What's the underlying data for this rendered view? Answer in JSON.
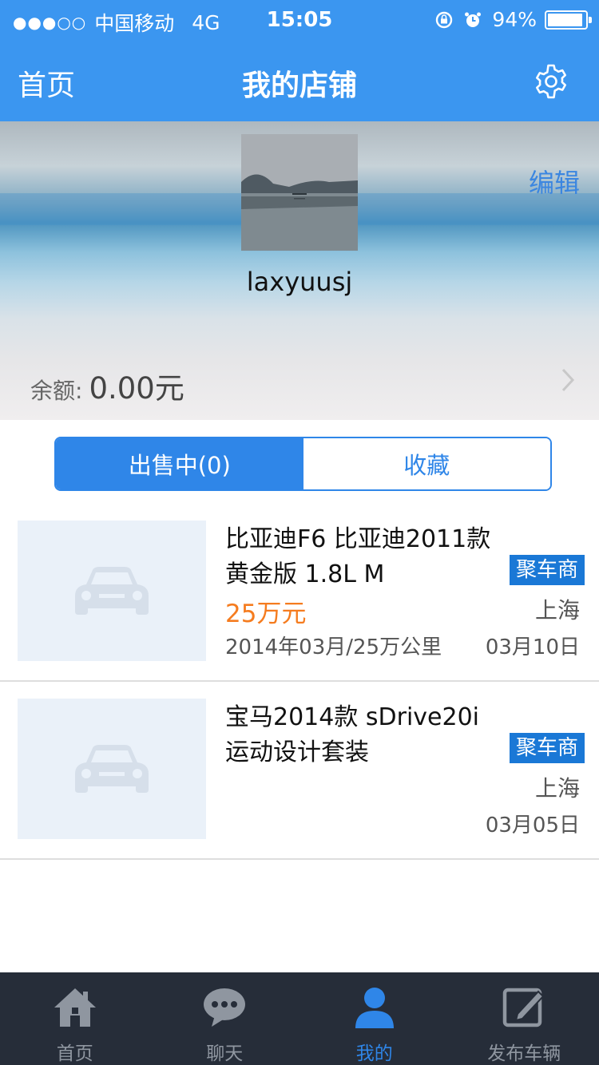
{
  "status_bar": {
    "signal": "●●●○○",
    "carrier": "中国移动",
    "network": "4G",
    "time": "15:05",
    "battery_text": "94%",
    "battery_level": 0.94
  },
  "nav": {
    "back_label": "首页",
    "title": "我的店铺",
    "settings_icon": "gear-icon"
  },
  "profile": {
    "username": "laxyuusj",
    "edit_label": "编辑",
    "balance_label": "余额:",
    "balance_value": "0.00元"
  },
  "segments": [
    {
      "label": "出售中(0)",
      "active": true
    },
    {
      "label": "收藏",
      "active": false
    }
  ],
  "listings": [
    {
      "title": "比亚迪F6 比亚迪2011款\n 黄金版 1.8L M",
      "badge": "聚车商",
      "price": "25万元",
      "city": "上海",
      "meta": "2014年03月/25万公里",
      "date": "03月10日"
    },
    {
      "title": "宝马2014款 sDrive20i\n运动设计套装",
      "badge": "聚车商",
      "price": "",
      "city": "上海",
      "meta": "",
      "date": "03月05日"
    }
  ],
  "tabbar": [
    {
      "label": "首页",
      "icon": "home-icon",
      "active": false
    },
    {
      "label": "聊天",
      "icon": "chat-icon",
      "active": false
    },
    {
      "label": "我的",
      "icon": "user-icon",
      "active": true
    },
    {
      "label": "发布车辆",
      "icon": "edit-icon",
      "active": false
    }
  ],
  "colors": {
    "primary": "#3b96f0",
    "accent_price": "#f57c1f",
    "badge": "#1a78d6",
    "tabbar_bg": "#262d39"
  }
}
